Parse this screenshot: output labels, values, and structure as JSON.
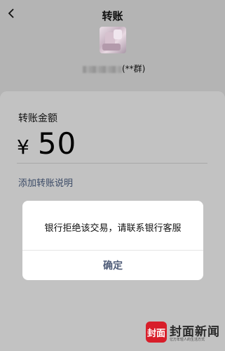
{
  "header": {
    "title": "转账",
    "back_icon": "chevron-left-icon"
  },
  "recipient": {
    "name_suffix": "(**群)"
  },
  "transfer": {
    "amount_label": "转账金额",
    "currency": "¥",
    "amount": "50",
    "add_note_label": "添加转账说明"
  },
  "dialog": {
    "message": "银行拒绝该交易，请联系银行客服",
    "confirm_label": "确定"
  },
  "watermark": {
    "seal": "封面",
    "name": "封面新闻",
    "tagline": "亿万年轻人的生活方式"
  },
  "colors": {
    "overlay_background": "#b4b4b4",
    "card_background": "#c2c2c2",
    "link": "#3b4a66",
    "confirm": "#4e5b77",
    "watermark_red": "#d81e2a"
  }
}
